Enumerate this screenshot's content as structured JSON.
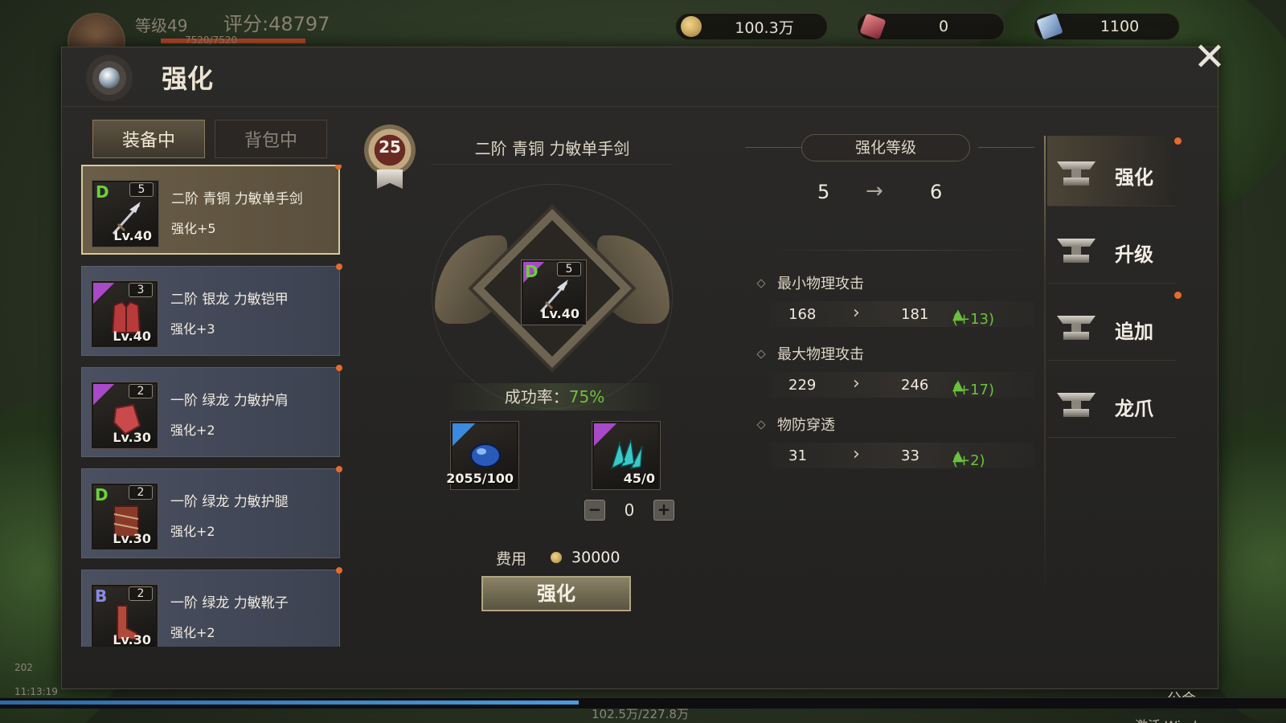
{
  "hud": {
    "level": "等级49",
    "score": "评分:48797",
    "hp": "7520/7520",
    "currencies": [
      {
        "icon": "coin-icon",
        "value": "100.3万"
      },
      {
        "icon": "gem-icon",
        "value": "0"
      },
      {
        "icon": "crystal-icon",
        "value": "1100"
      }
    ]
  },
  "panel": {
    "title": "强化",
    "close": "✕",
    "tabs": [
      {
        "label": "装备中",
        "active": true
      },
      {
        "label": "背包中",
        "active": false
      }
    ]
  },
  "equipment": [
    {
      "grade": "D",
      "enh_badge": "5",
      "lv": "Lv.40",
      "name": "二阶 青铜 力敏单手剑",
      "enhance": "强化+5",
      "selected": true,
      "icon": "sword-icon"
    },
    {
      "grade": "",
      "enh_badge": "3",
      "lv": "Lv.40",
      "name": "二阶 银龙 力敏铠甲",
      "enhance": "强化+3",
      "selected": false,
      "icon": "armor-icon"
    },
    {
      "grade": "",
      "enh_badge": "2",
      "lv": "Lv.30",
      "name": "一阶 绿龙 力敏护肩",
      "enhance": "强化+2",
      "selected": false,
      "icon": "pauldron-icon"
    },
    {
      "grade": "D",
      "enh_badge": "2",
      "lv": "Lv.30",
      "name": "一阶 绿龙 力敏护腿",
      "enhance": "强化+2",
      "selected": false,
      "icon": "greaves-icon"
    },
    {
      "grade": "B",
      "enh_badge": "2",
      "lv": "Lv.30",
      "name": "一阶 绿龙 力敏靴子",
      "enhance": "强化+2",
      "selected": false,
      "icon": "boots-icon"
    }
  ],
  "center": {
    "badge_level": "25",
    "item_title": "二阶 青铜 力敏单手剑",
    "item": {
      "grade": "D",
      "enh_badge": "5",
      "lv": "Lv.40"
    },
    "success_label": "成功率：",
    "success_value": "75%",
    "materials": [
      {
        "icon": "blue-stone-icon",
        "count": "2055/100",
        "rarity": "blue"
      },
      {
        "icon": "cyan-crystal-icon",
        "count": "45/0",
        "rarity": "purple"
      }
    ],
    "stepper_value": "0",
    "cost_label": "费用",
    "cost_value": "30000",
    "enhance_button": "强化"
  },
  "stats": {
    "header": "强化等级",
    "level_from": "5",
    "level_to": "6",
    "rows": [
      {
        "name": "最小物理攻击",
        "from": "168",
        "to": "181",
        "delta": "(+13)"
      },
      {
        "name": "最大物理攻击",
        "from": "229",
        "to": "246",
        "delta": "(+17)"
      },
      {
        "name": "物防穿透",
        "from": "31",
        "to": "33",
        "delta": "(+2)"
      }
    ]
  },
  "menu": [
    {
      "label": "强化",
      "active": true,
      "dot": true
    },
    {
      "label": "升级",
      "active": false,
      "dot": false
    },
    {
      "label": "追加",
      "active": false,
      "dot": true
    },
    {
      "label": "龙爪",
      "active": false,
      "dot": false
    }
  ],
  "bottom": {
    "exp_text": "102.5万/227.8万",
    "exp_fraction": 0.45,
    "clock_date": "202",
    "clock_time": "11:13:19",
    "guild": "公会",
    "windows": "激活 Windows"
  }
}
